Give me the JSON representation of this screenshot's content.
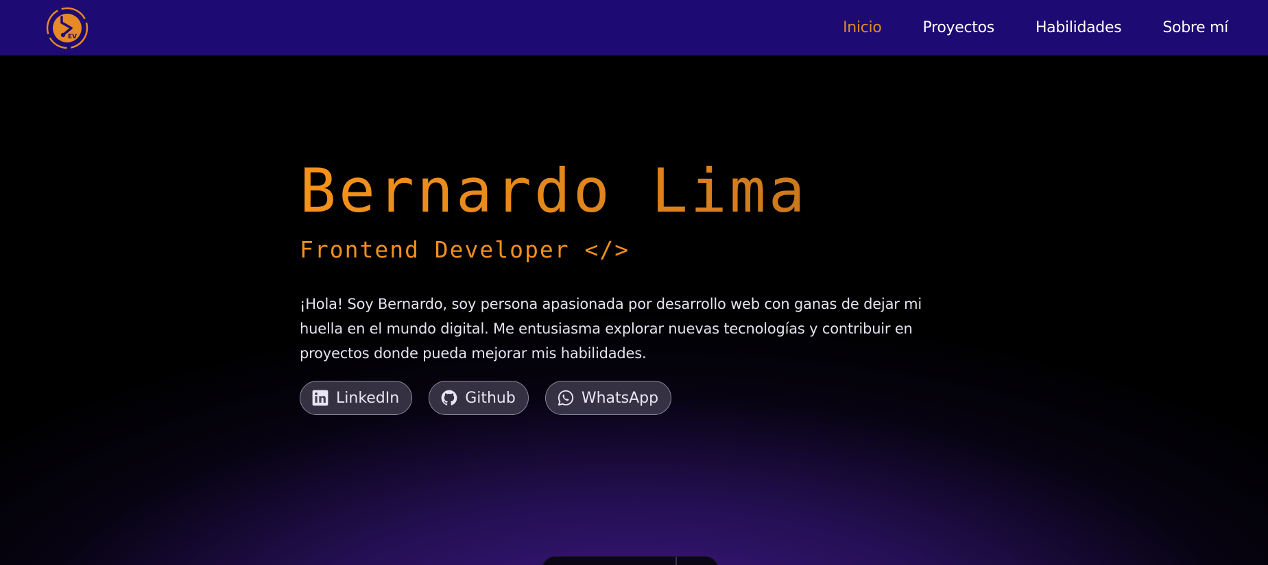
{
  "navbar": {
    "logo_text": "EV",
    "links": [
      {
        "label": "Inicio",
        "active": true
      },
      {
        "label": "Proyectos",
        "active": false
      },
      {
        "label": "Habilidades",
        "active": false
      },
      {
        "label": "Sobre mí",
        "active": false
      }
    ]
  },
  "hero": {
    "name": "Bernardo Lima",
    "role": "Frontend Developer </>",
    "bio": "¡Hola! Soy Bernardo, soy persona apasionada por desarrollo web con ganas de dejar mi huella en el mundo digital. Me entusiasma explorar nuevas tecnologías y contribuir en proyectos donde pueda mejorar mis habilidades.",
    "socials": [
      {
        "label": "LinkedIn",
        "icon": "linkedin-icon"
      },
      {
        "label": "Github",
        "icon": "github-icon"
      },
      {
        "label": "WhatsApp",
        "icon": "whatsapp-icon"
      }
    ]
  },
  "colors": {
    "navbar_bg": "#1d0a72",
    "accent": "#e08a2c",
    "background": "#000000",
    "glow": "#461c96"
  }
}
